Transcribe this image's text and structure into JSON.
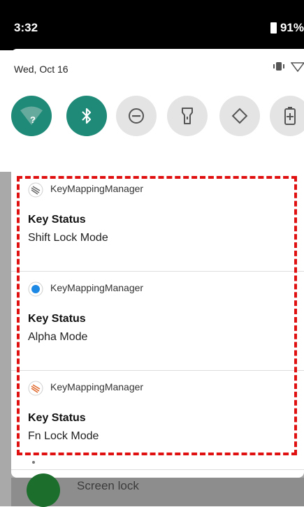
{
  "status_bar": {
    "time": "3:32",
    "battery": "91%"
  },
  "quick_settings": {
    "date": "Wed, Oct 16",
    "tiles": [
      {
        "icon": "wifi-icon",
        "state": "on"
      },
      {
        "icon": "bluetooth-icon",
        "state": "on"
      },
      {
        "icon": "do-not-disturb-icon",
        "state": "off"
      },
      {
        "icon": "flashlight-icon",
        "state": "off"
      },
      {
        "icon": "auto-rotate-icon",
        "state": "off"
      },
      {
        "icon": "battery-saver-icon",
        "state": "off"
      }
    ]
  },
  "notifications": [
    {
      "app": "KeyMappingManager",
      "title": "Key Status",
      "text": "Shift Lock Mode",
      "icon": "shift-lock-icon"
    },
    {
      "app": "KeyMappingManager",
      "title": "Key Status",
      "text": "Alpha Mode",
      "icon": "alpha-mode-icon"
    },
    {
      "app": "KeyMappingManager",
      "title": "Key Status",
      "text": "Fn Lock Mode",
      "icon": "fn-lock-icon"
    }
  ],
  "bottom": {
    "screen_lock_label": "Screen lock"
  },
  "colors": {
    "accent": "#1f8a78",
    "highlight": "#e01010",
    "status_bar": "#000000"
  }
}
